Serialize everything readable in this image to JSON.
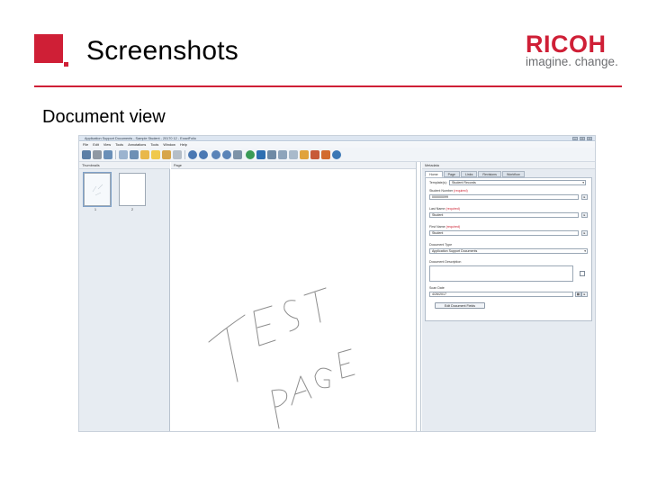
{
  "slide": {
    "title": "Screenshots",
    "subtitle": "Document view"
  },
  "logo": {
    "word": "RICOH",
    "tagline": "imagine. change."
  },
  "colors": {
    "brand_red": "#cf1f36",
    "tagline_gray": "#6d6e71"
  },
  "app": {
    "window_title": "Application Support Documents - Sample Student - 20170 12 - ExactFolio",
    "window_buttons": [
      "–",
      "□",
      "×"
    ],
    "menu": [
      "File",
      "Edit",
      "View",
      "Tools",
      "Annotations",
      "Tools",
      "Window",
      "Help"
    ],
    "toolbar_icons": [
      "save-icon",
      "print-icon",
      "scan-icon",
      "edit-icon",
      "folder-icon",
      "pen-icon",
      "highlighter-icon",
      "page-icon",
      "prev-icon",
      "next-icon",
      "zoom-in-icon",
      "zoom-out-icon",
      "refresh-icon",
      "approve-icon",
      "image-icon",
      "list-icon",
      "stack-icon",
      "gear-icon",
      "help-icon"
    ],
    "thumbnails_header": "Thumbnails",
    "page_header": "Page",
    "thumbnails": [
      {
        "number": "1",
        "selected": true
      },
      {
        "number": "2",
        "selected": false
      }
    ],
    "handwriting": {
      "line1": "TEST",
      "line2": "PAGE"
    },
    "properties": {
      "header": "Metadata",
      "tabs": [
        "Home",
        "Page",
        "Links",
        "Revisions",
        "Workflow"
      ],
      "template_label": "Template(s):",
      "template_value": "Student Records",
      "fields": [
        {
          "label": "Student Number",
          "required_tag": "(required)",
          "value": "000000099"
        },
        {
          "label": "Last Name",
          "required_tag": "(required)",
          "value": "Student"
        },
        {
          "label": "First Name",
          "required_tag": "(required)",
          "value": "Student"
        },
        {
          "label": "Document Type",
          "required_tag": "",
          "value": "Application Support Documents"
        }
      ],
      "description_label": "Document Description",
      "date_label": "Scan Date",
      "date_value": "4/26/2017",
      "barcode_button": "Edit Document Fields"
    }
  }
}
